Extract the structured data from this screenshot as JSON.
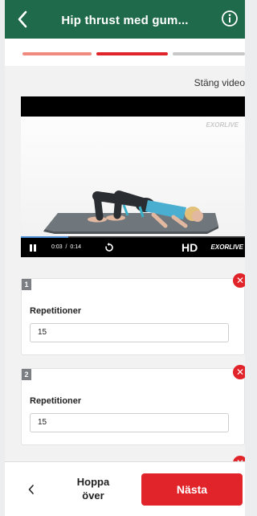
{
  "header": {
    "title": "Hip thrust med gum...",
    "back_icon": "chevron-left-icon",
    "info_icon": "info-circle-icon",
    "background_color": "#1f6a4a"
  },
  "progress": {
    "segments": [
      "completed",
      "current",
      "upcoming"
    ],
    "colors": {
      "completed": "#f08a80",
      "current": "#e0242a",
      "upcoming": "#c8c8c8"
    }
  },
  "video": {
    "close_label": "Stäng video",
    "watermark": "EXORLIVE",
    "time_current": "0:03",
    "time_separator": "/",
    "time_total": "0:14",
    "progress": 0.21,
    "quality": "HD",
    "brand": "EXORLIVE"
  },
  "sets": [
    {
      "number": "1",
      "label": "Repetitioner",
      "value": "15"
    },
    {
      "number": "2",
      "label": "Repetitioner",
      "value": "15"
    }
  ],
  "footer": {
    "skip_label_line1": "Hoppa",
    "skip_label_line2": "över",
    "next_label": "Nästa",
    "accent_color": "#e0242a"
  }
}
